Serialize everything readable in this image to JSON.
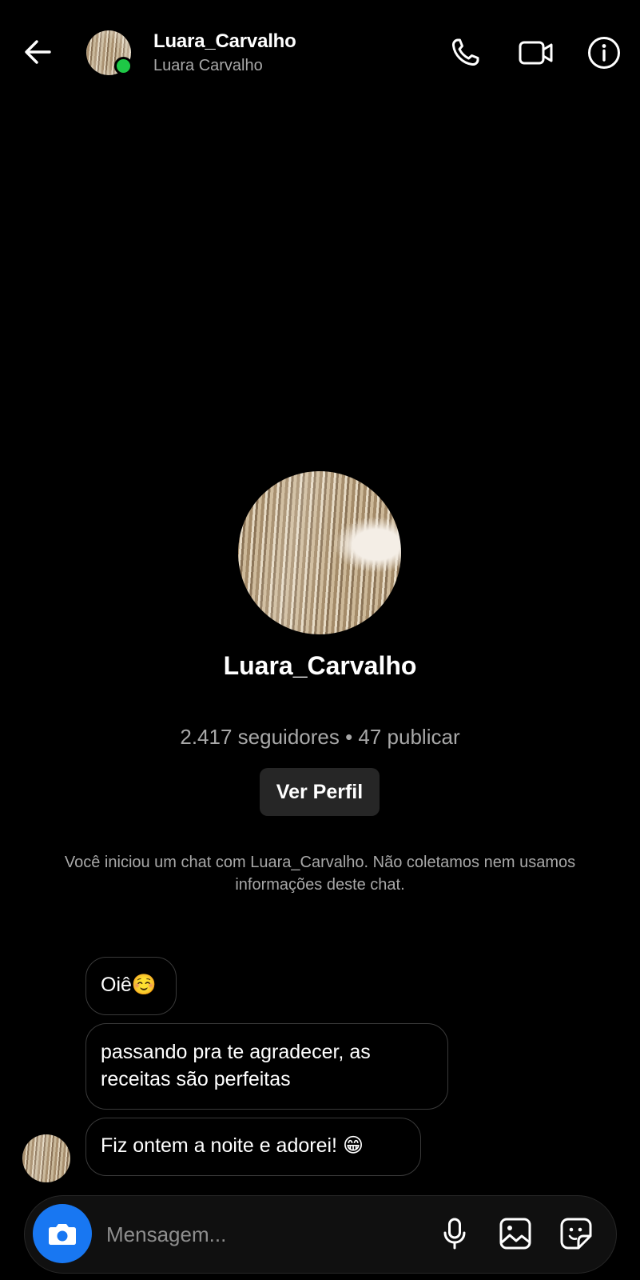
{
  "header": {
    "username": "Luara_Carvalho",
    "full_name": "Luara Carvalho",
    "online": true,
    "icons": [
      "arrow-left-icon",
      "phone-icon",
      "video-camera-icon",
      "info-icon"
    ]
  },
  "profile": {
    "username": "Luara_Carvalho",
    "stats": "2.417 seguidores • 47 publicar",
    "view_profile_label": "Ver Perfil"
  },
  "notice": "Você iniciou um chat com Luara_Carvalho. Não coletamos nem usamos informações deste chat.",
  "messages": [
    {
      "text": "Oiê☺️"
    },
    {
      "text": "passando pra te agradecer, as receitas são perfeitas"
    },
    {
      "text": "Fiz ontem a noite e adorei! 😁"
    }
  ],
  "composer": {
    "placeholder": "Mensagem...",
    "icons": [
      "camera-icon",
      "microphone-icon",
      "gallery-icon",
      "sticker-icon"
    ]
  },
  "colors": {
    "background": "#000000",
    "accent": "#1877f2",
    "online": "#1ec846",
    "secondary_text": "#a8a8a8",
    "button_bg": "#262626"
  }
}
